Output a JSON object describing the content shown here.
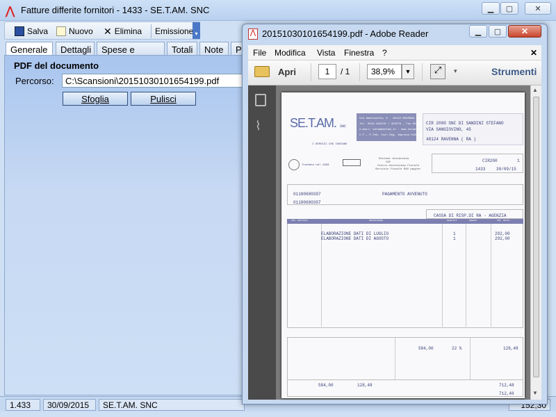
{
  "back_window": {
    "title": "Fatture differite fornitori - 1433 - SE.T.AM. SNC",
    "toolbar": {
      "save": "Salva",
      "new": "Nuovo",
      "delete": "Elimina",
      "issue": "Emissione"
    },
    "tabs": [
      "Generale",
      "Dettagli",
      "Spese e Sconti",
      "Totali",
      "Note",
      "PD"
    ],
    "section_title": "PDF del documento",
    "path_label": "Percorso:",
    "path_value": "C:\\Scansioni\\20151030101654199.pdf",
    "browse": "Sfoglia",
    "clear": "Pulisci",
    "status": {
      "number": "1.433",
      "date": "30/09/2015",
      "supplier": "SE.T.AM. SNC",
      "right": "152,30"
    }
  },
  "reader": {
    "title": "20151030101654199.pdf - Adobe Reader",
    "menu": [
      "File",
      "Modifica",
      "Vista",
      "Finestra",
      "?"
    ],
    "open": "Apri",
    "page_current": "1",
    "page_total": "/ 1",
    "zoom": "38,9%",
    "tools": "Strumenti"
  },
  "invoice": {
    "company_logo": "SE.T.AM.",
    "company_logo_suffix": "SNC",
    "logo_tagline": "I SERVIZI CHE CONTANO",
    "company_block": [
      "Via Amalasunta, 6 - 48122 RAVENNA",
      "Tel. 0544.456476 / 453279 - Fax 0544.453770",
      "e-mail: setam@setam.it - www.setam.it",
      "C.F., P.IVA, Iscr.Reg. Imprese 01818790393"
    ],
    "founded": "Fondata nel 1983",
    "caf_block": [
      "Sezione distaccata",
      "CAF",
      "Centro Assistenza Fiscale",
      "Servizio fiscale RAV pagine"
    ],
    "customer": [
      "CIR 2000 SNC DI SANDINI STEFANO",
      "VIA SANGIOVINO, 45",
      "48124 RAVENNA ( RA )"
    ],
    "customer_code": "CIR200",
    "doc_page": "1",
    "doc_number": "1433",
    "doc_date": "30/09/15",
    "vat_id": "01180680397",
    "tax_code": "01180680397",
    "payment": "PAGAMENTO AVVENUTO",
    "bank": "CASSA DI RISP.DI RA - AGENZIA",
    "columns": [
      "COD. ARTICOLO",
      "DESCRIZIONE",
      "QUANTITÀ",
      "PREZZO",
      "IMP. NETTO"
    ],
    "lines": [
      {
        "desc": "ELABORAZIONE DATI DI LUGLIO",
        "qty": "1",
        "amount": "292,00"
      },
      {
        "desc": "ELABORAZIONE DATI DI AGOSTO",
        "qty": "1",
        "amount": "292,00"
      }
    ],
    "taxable": "584,00",
    "vat_rate": "22 %",
    "vat_amount": "128,48",
    "total_taxable": "584,00",
    "total_vat": "128,48",
    "total_doc": "712,48",
    "total_due": "712,48"
  }
}
